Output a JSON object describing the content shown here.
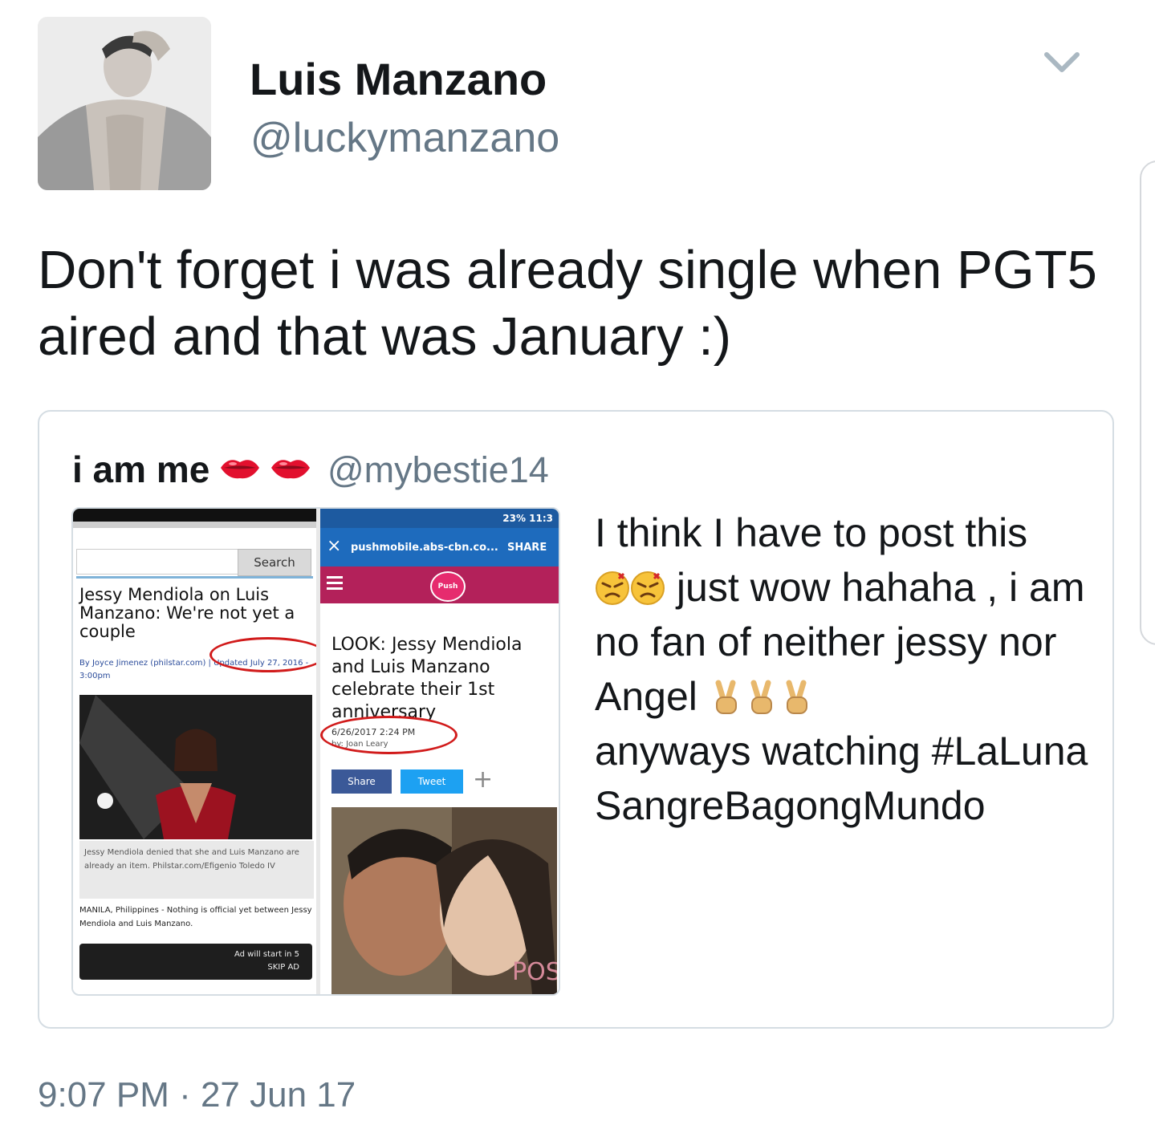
{
  "tweet": {
    "display_name": "Luis Manzano",
    "handle": "@luckymanzano",
    "text": "Don't forget i was already single when PGT5 aired and that was January :)",
    "timestamp": "9:07 PM · 27 Jun 17",
    "menu_icon": "chevron-down-icon"
  },
  "quoted_tweet": {
    "display_name": "i am me",
    "name_emoji": "kiss-mark-icon",
    "handle": "@mybestie14",
    "text_1": "I think I have to post this",
    "text_2": "just wow hahaha , i am no fan of neither jessy nor Angel",
    "text_3": "anyways watching #LaLunaSangreBagongMundo",
    "emoji_1": "angry-face-icon",
    "emoji_2": "victory-hand-icon"
  },
  "media": {
    "left": {
      "search_button": "Search",
      "headline": "Jessy Mendiola on Luis Manzano: We're not yet a couple",
      "byline": "By Joyce Jimenez (philstar.com) | Updated July 27, 2016 - 3:00pm",
      "caption": "Jessy Mendiola denied that she and Luis Manzano are already an item. Philstar.com/Efigenio Toledo IV",
      "body": "MANILA, Philippines - Nothing is official yet between Jessy Mendiola and Luis Manzano.",
      "ad_line_1": "Ad will start in 5",
      "ad_line_2": "SKIP AD"
    },
    "right": {
      "status_bar": "23% 11:3",
      "url": "pushmobile.abs-cbn.co...",
      "share": "SHARE",
      "close": "×",
      "logo": "Push",
      "headline": "LOOK: Jessy Mendiola and Luis Manzano celebrate their 1st anniversary",
      "date": "6/26/2017 2:24 PM",
      "author": "by: Joan Leary",
      "share_button": "Share",
      "tweet_button": "Tweet",
      "plus": "+",
      "watermark": "POST"
    }
  }
}
